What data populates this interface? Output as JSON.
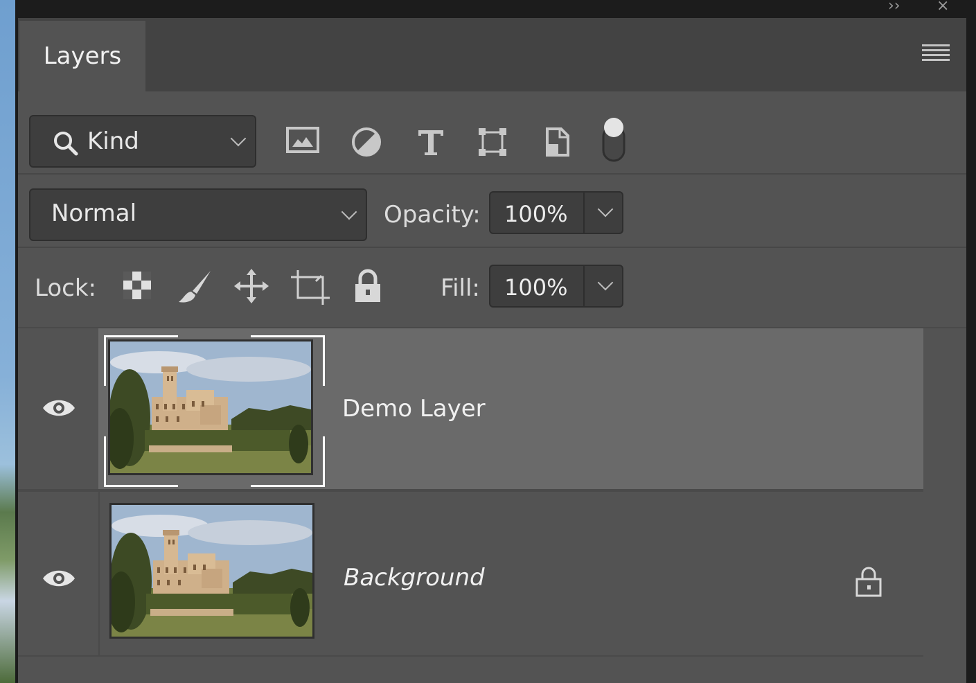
{
  "panel": {
    "tab_label": "Layers"
  },
  "filter": {
    "kind_label": "Kind",
    "icons": [
      "pixel-layer-filter-icon",
      "adjustment-layer-filter-icon",
      "type-layer-filter-icon",
      "shape-layer-filter-icon",
      "smart-object-filter-icon",
      "filter-toggle-icon"
    ]
  },
  "blend": {
    "mode": "Normal",
    "opacity_label": "Opacity:",
    "opacity_value": "100%"
  },
  "lock": {
    "label": "Lock:",
    "icons": [
      "lock-transparent-pixels-icon",
      "lock-image-pixels-icon",
      "lock-position-icon",
      "lock-artboard-icon",
      "lock-all-icon"
    ],
    "fill_label": "Fill:",
    "fill_value": "100%"
  },
  "layers": [
    {
      "name": "Demo Layer",
      "selected": true,
      "visible": true,
      "locked": false
    },
    {
      "name": "Background",
      "selected": false,
      "visible": true,
      "locked": true
    }
  ],
  "colors": {
    "panel_bg": "#535353",
    "tabbar_bg": "#434343",
    "selected_layer_bg": "#6a6a6a",
    "field_bg": "#3e3e3e"
  }
}
